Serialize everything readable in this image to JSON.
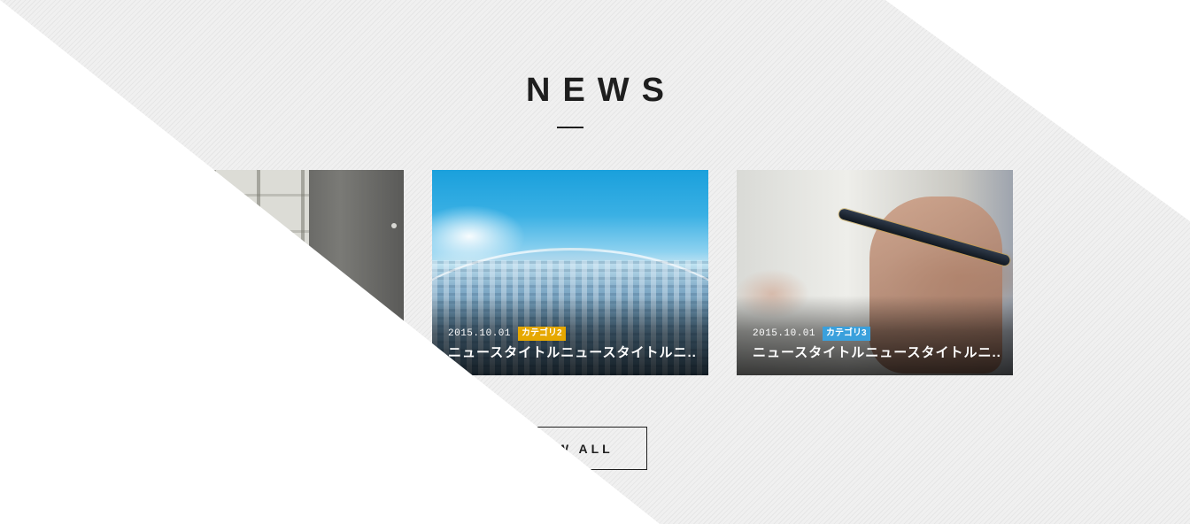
{
  "section": {
    "title": "NEWS"
  },
  "cards": [
    {
      "image": "office-ceiling-photo",
      "date": "",
      "category": "",
      "title": ""
    },
    {
      "image": "city-earth-photo",
      "date": "2015.10.01",
      "category": "カテゴリ2",
      "category_color": "#e6a800",
      "title": "ニュースタイトルニュースタイトルニ..."
    },
    {
      "image": "hand-pen-photo",
      "date": "2015.10.01",
      "category": "カテゴリ3",
      "category_color": "#3aa0dc",
      "title": "ニュースタイトルニュースタイトルニ..."
    }
  ],
  "view_all": {
    "label": "VIEW ALL"
  }
}
